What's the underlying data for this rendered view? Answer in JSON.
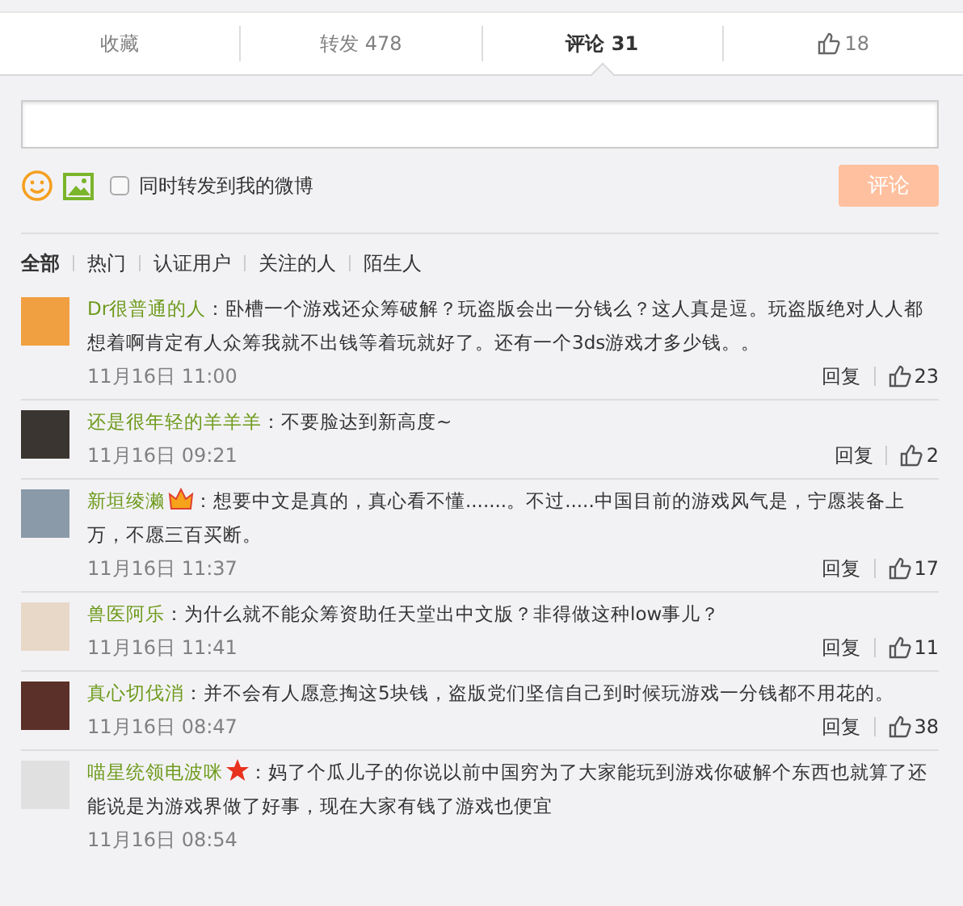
{
  "tabs": [
    {
      "label": "收藏",
      "selected": false,
      "kind": "text"
    },
    {
      "label": "转发 478",
      "selected": false,
      "kind": "text"
    },
    {
      "label": "评论 31",
      "selected": true,
      "kind": "text"
    },
    {
      "label": "18",
      "selected": false,
      "kind": "like"
    }
  ],
  "composer": {
    "checkbox_label": "同时转发到我的微博",
    "checked": false,
    "submit": "评论"
  },
  "filters": [
    {
      "label": "全部",
      "selected": true
    },
    {
      "label": "热门",
      "selected": false
    },
    {
      "label": "认证用户",
      "selected": false
    },
    {
      "label": "关注的人",
      "selected": false
    },
    {
      "label": "陌生人",
      "selected": false
    }
  ],
  "comments": [
    {
      "user": "Dr很普通的人",
      "kind": "plain",
      "text": "：卧槽一个游戏还众筹破解？玩盗版会出一分钱么？这人真是逗。玩盗版绝对人人都想着啊肯定有人众筹我就不出钱等着玩就好了。还有一个3ds游戏才多少钱。。",
      "time": "11月16日 11:00",
      "reply": "回复",
      "likes": "23"
    },
    {
      "user": "还是很年轻的羊羊羊",
      "kind": "plain",
      "text": "：不要脸达到新高度~",
      "time": "11月16日 09:21",
      "reply": "回复",
      "likes": "2"
    },
    {
      "user": "新垣绫濑",
      "kind": "crown",
      "text": "：想要中文是真的，真心看不懂.......。不过.....中国目前的游戏风气是，宁愿装备上万，不愿三百买断。",
      "time": "11月16日 11:37",
      "reply": "回复",
      "likes": "17"
    },
    {
      "user": "兽医阿乐",
      "kind": "plain",
      "text": "：为什么就不能众筹资助任天堂出中文版？非得做这种low事儿？",
      "time": "11月16日 11:41",
      "reply": "回复",
      "likes": "11"
    },
    {
      "user": "真心切伐消",
      "kind": "plain",
      "text": "：并不会有人愿意掏这5块钱，盗版党们坚信自己到时候玩游戏一分钱都不用花的。",
      "time": "11月16日 08:47",
      "reply": "回复",
      "likes": "38"
    },
    {
      "user": "喵星统领电波咪",
      "kind": "star",
      "text": "：妈了个瓜儿子的你说以前中国穷为了大家能玩到游戏你破解个东西也就算了还能说是为游戏界做了好事，现在大家有钱了游戏也便宜",
      "time": "11月16日 08:54"
    }
  ]
}
